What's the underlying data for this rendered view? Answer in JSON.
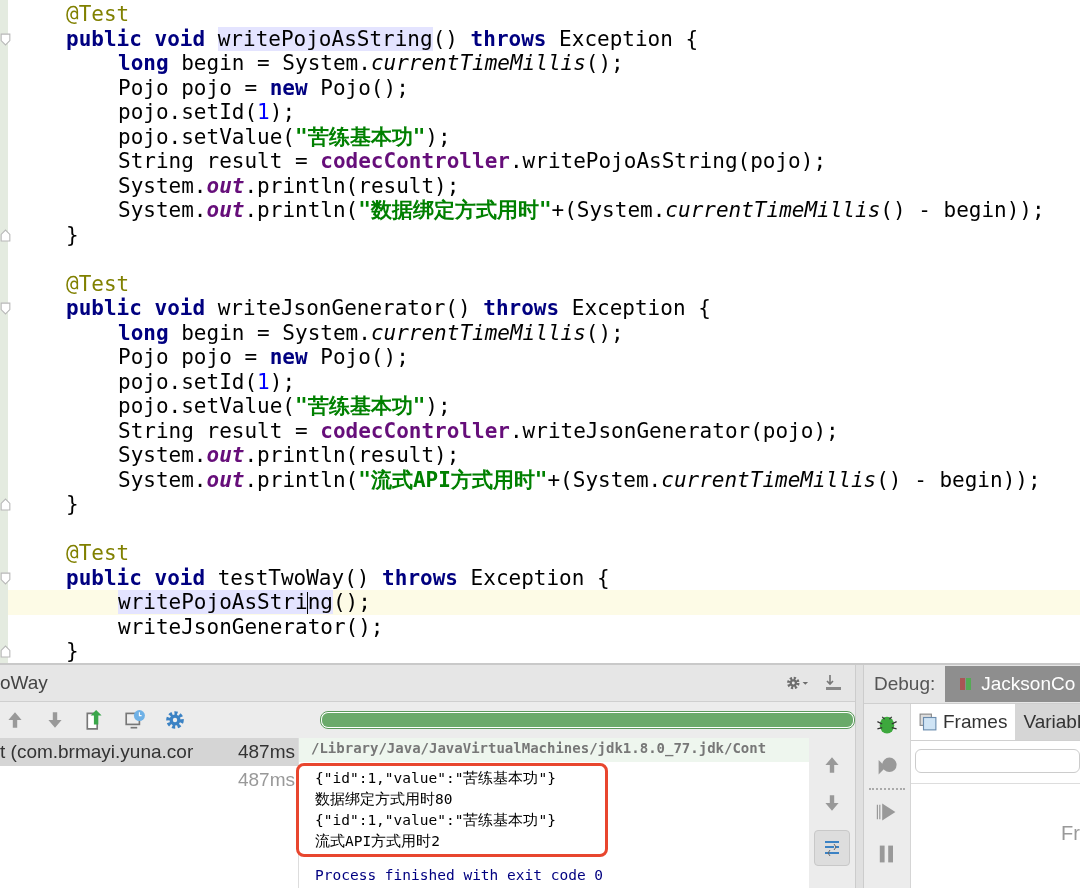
{
  "editor": {
    "methods": [
      {
        "annotation": "@Test",
        "signature": [
          {
            "t": "public void ",
            "kind": "kw"
          },
          {
            "t": "writePojoAsString",
            "kind": "hl"
          },
          {
            "t": "() ",
            "kind": "plain"
          },
          {
            "t": "throws",
            "kind": "kw"
          },
          {
            "t": " Exception {",
            "kind": "plain"
          }
        ],
        "body": [
          {
            "current": false,
            "tokens": [
              {
                "t": "long",
                "kind": "kw"
              },
              {
                "t": " begin = System.",
                "kind": "plain"
              },
              {
                "t": "currentTimeMillis",
                "kind": "static"
              },
              {
                "t": "();",
                "kind": "plain"
              }
            ]
          },
          {
            "current": false,
            "tokens": [
              {
                "t": "Pojo pojo = ",
                "kind": "plain"
              },
              {
                "t": "new",
                "kind": "kw"
              },
              {
                "t": " Pojo();",
                "kind": "plain"
              }
            ]
          },
          {
            "current": false,
            "tokens": [
              {
                "t": "pojo.setId(",
                "kind": "plain"
              },
              {
                "t": "1",
                "kind": "num"
              },
              {
                "t": ");",
                "kind": "plain"
              }
            ]
          },
          {
            "current": false,
            "tokens": [
              {
                "t": "pojo.setValue(",
                "kind": "plain"
              },
              {
                "t": "\"苦练基本功\"",
                "kind": "str"
              },
              {
                "t": ");",
                "kind": "plain"
              }
            ]
          },
          {
            "current": false,
            "tokens": [
              {
                "t": "String result = ",
                "kind": "plain"
              },
              {
                "t": "codecController",
                "kind": "field"
              },
              {
                "t": ".writePojoAsString(pojo);",
                "kind": "plain"
              }
            ]
          },
          {
            "current": false,
            "tokens": [
              {
                "t": "System.",
                "kind": "plain"
              },
              {
                "t": "out",
                "kind": "sfield"
              },
              {
                "t": ".println(result);",
                "kind": "plain"
              }
            ]
          },
          {
            "current": false,
            "tokens": [
              {
                "t": "System.",
                "kind": "plain"
              },
              {
                "t": "out",
                "kind": "sfield"
              },
              {
                "t": ".println(",
                "kind": "plain"
              },
              {
                "t": "\"数据绑定方式用时\"",
                "kind": "str"
              },
              {
                "t": "+(System.",
                "kind": "plain"
              },
              {
                "t": "currentTimeMillis",
                "kind": "static"
              },
              {
                "t": "() - begin));",
                "kind": "plain"
              }
            ]
          }
        ],
        "close": "}"
      },
      {
        "annotation": "@Test",
        "signature": [
          {
            "t": "public void ",
            "kind": "kw"
          },
          {
            "t": "writeJsonGenerator",
            "kind": "plain"
          },
          {
            "t": "() ",
            "kind": "plain"
          },
          {
            "t": "throws",
            "kind": "kw"
          },
          {
            "t": " Exception {",
            "kind": "plain"
          }
        ],
        "body": [
          {
            "current": false,
            "tokens": [
              {
                "t": "long",
                "kind": "kw"
              },
              {
                "t": " begin = System.",
                "kind": "plain"
              },
              {
                "t": "currentTimeMillis",
                "kind": "static"
              },
              {
                "t": "();",
                "kind": "plain"
              }
            ]
          },
          {
            "current": false,
            "tokens": [
              {
                "t": "Pojo pojo = ",
                "kind": "plain"
              },
              {
                "t": "new",
                "kind": "kw"
              },
              {
                "t": " Pojo();",
                "kind": "plain"
              }
            ]
          },
          {
            "current": false,
            "tokens": [
              {
                "t": "pojo.setId(",
                "kind": "plain"
              },
              {
                "t": "1",
                "kind": "num"
              },
              {
                "t": ");",
                "kind": "plain"
              }
            ]
          },
          {
            "current": false,
            "tokens": [
              {
                "t": "pojo.setValue(",
                "kind": "plain"
              },
              {
                "t": "\"苦练基本功\"",
                "kind": "str"
              },
              {
                "t": ");",
                "kind": "plain"
              }
            ]
          },
          {
            "current": false,
            "tokens": [
              {
                "t": "String result = ",
                "kind": "plain"
              },
              {
                "t": "codecController",
                "kind": "field"
              },
              {
                "t": ".writeJsonGenerator(pojo);",
                "kind": "plain"
              }
            ]
          },
          {
            "current": false,
            "tokens": [
              {
                "t": "System.",
                "kind": "plain"
              },
              {
                "t": "out",
                "kind": "sfield"
              },
              {
                "t": ".println(result);",
                "kind": "plain"
              }
            ]
          },
          {
            "current": false,
            "tokens": [
              {
                "t": "System.",
                "kind": "plain"
              },
              {
                "t": "out",
                "kind": "sfield"
              },
              {
                "t": ".println(",
                "kind": "plain"
              },
              {
                "t": "\"流式API方式用时\"",
                "kind": "str"
              },
              {
                "t": "+(System.",
                "kind": "plain"
              },
              {
                "t": "currentTimeMillis",
                "kind": "static"
              },
              {
                "t": "() - begin));",
                "kind": "plain"
              }
            ]
          }
        ],
        "close": "}"
      },
      {
        "annotation": "@Test",
        "signature": [
          {
            "t": "public void ",
            "kind": "kw"
          },
          {
            "t": "testTwoWay",
            "kind": "plain"
          },
          {
            "t": "() ",
            "kind": "plain"
          },
          {
            "t": "throws",
            "kind": "kw"
          },
          {
            "t": " Exception {",
            "kind": "plain"
          }
        ],
        "body": [
          {
            "current": true,
            "tokens": [
              {
                "t": "writePojoAsStri",
                "kind": "hl",
                "caret_after": true
              },
              {
                "t": "ng",
                "kind": "hl"
              },
              {
                "t": "();",
                "kind": "plain"
              }
            ]
          },
          {
            "current": false,
            "tokens": [
              {
                "t": "writeJsonGenerator();",
                "kind": "plain"
              }
            ]
          }
        ],
        "close": "}"
      }
    ]
  },
  "run_panel": {
    "title": "oWay",
    "progress": {
      "level": 1
    },
    "tests": [
      {
        "name": "t (com.brmayi.yuna.cor",
        "time": "487ms",
        "selected": true
      },
      {
        "time": "487ms",
        "selected": false
      }
    ],
    "console": {
      "command": "/Library/Java/JavaVirtualMachines/jdk1.8.0_77.jdk/Cont",
      "boxed_output": [
        "{\"id\":1,\"value\":\"苦练基本功\"}",
        "数据绑定方式用时80",
        "{\"id\":1,\"value\":\"苦练基本功\"}",
        "流式API方式用时2"
      ],
      "exit_message": "Process finished with exit code 0"
    },
    "soft_wrap": {
      "selected": true
    }
  },
  "debug_panel": {
    "label": "Debug:",
    "session_tab": "JacksonCo",
    "tabs": [
      {
        "label": "Frames",
        "selected": true
      },
      {
        "label": "Variabl",
        "selected": false
      }
    ],
    "empty_text": "Fr"
  }
}
